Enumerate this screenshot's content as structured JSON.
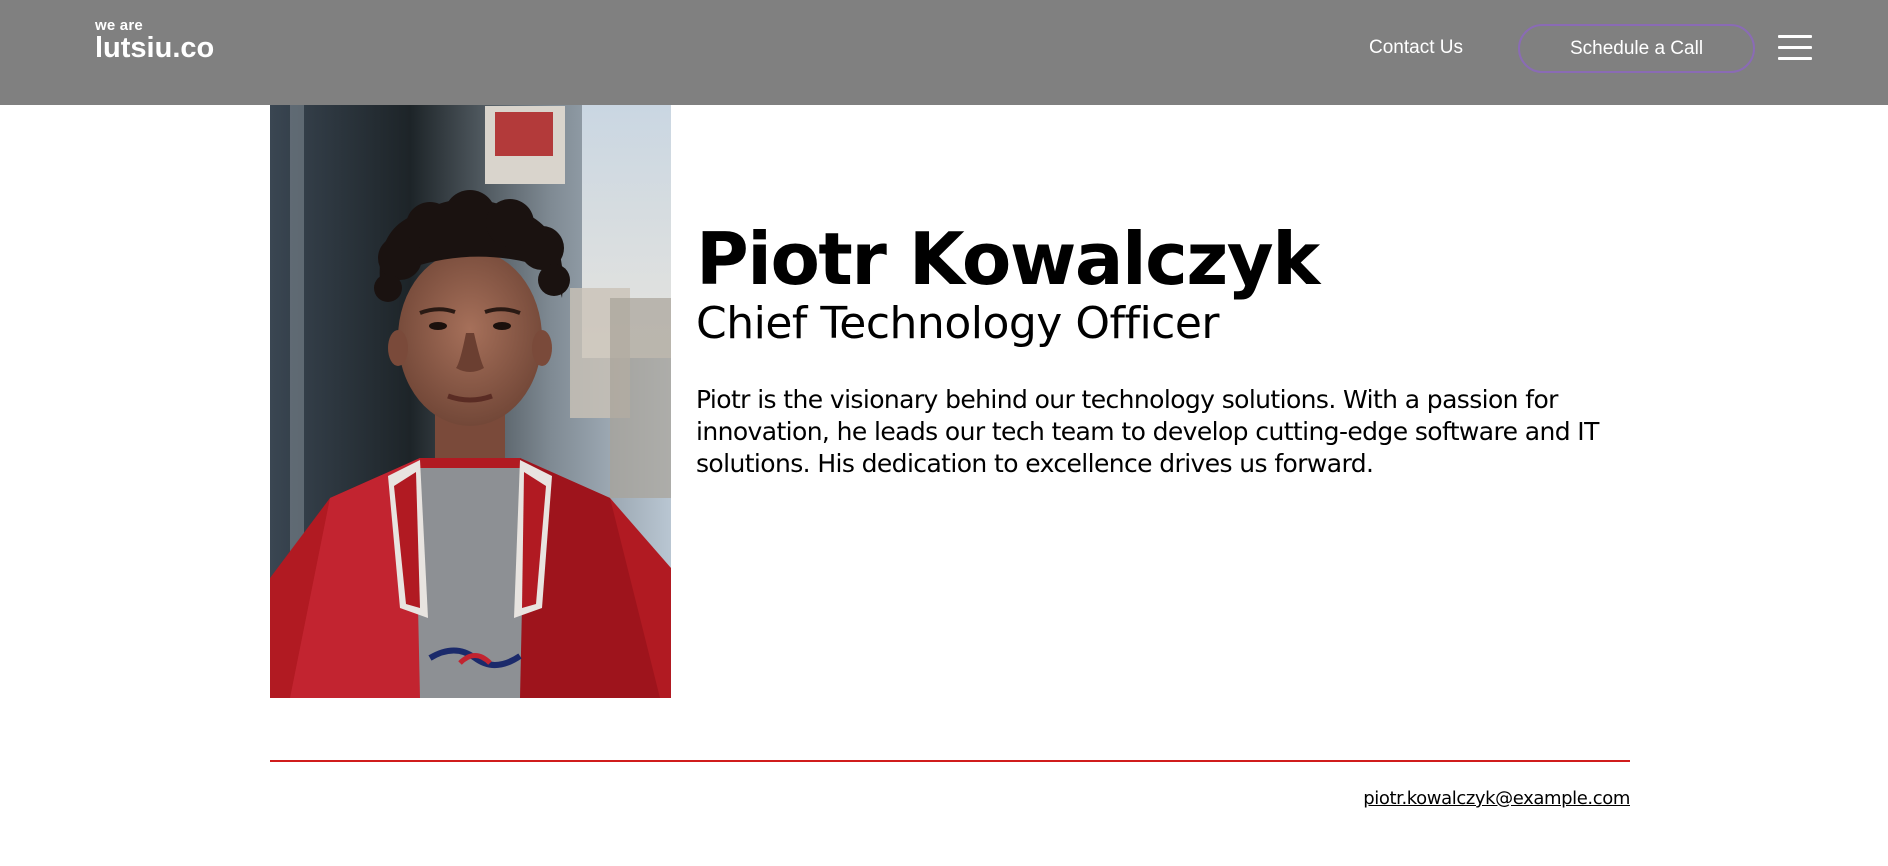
{
  "header": {
    "logo_small": "we are",
    "logo_big": "lutsiu.co",
    "contact_label": "Contact Us",
    "cta_label": "Schedule a Call",
    "menu_icon": "hamburger-icon"
  },
  "colors": {
    "header_bg": "#808080",
    "cta_border": "#8a6bb5",
    "divider": "#d01c1c"
  },
  "profile": {
    "name": "Piotr Kowalczyk",
    "role": "Chief Technology Officer",
    "bio": "Piotr is the visionary behind our technology solutions. With a passion for innovation, he leads our tech team to develop cutting-edge software and IT solutions. His dedication to excellence drives us forward.",
    "email": "piotr.kowalczyk@example.com"
  }
}
